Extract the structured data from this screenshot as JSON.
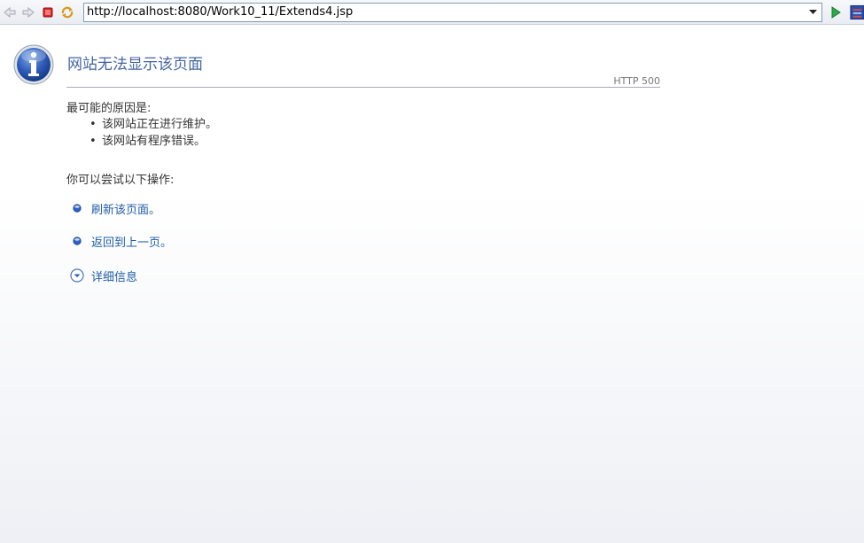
{
  "toolbar": {
    "back_icon": "back-arrow-icon",
    "forward_icon": "forward-arrow-icon",
    "stop_icon": "stop-icon",
    "refresh_icon": "refresh-icon",
    "url": "http://localhost:8080/Work10_11/Extends4.jsp",
    "go_icon": "go-arrow-icon",
    "menu_icon": "menu-icon"
  },
  "error": {
    "icon": "info-icon",
    "title": "网站无法显示该页面",
    "code": "HTTP 500",
    "causes_heading": "最可能的原因是:",
    "causes": [
      "该网站正在进行维护。",
      "该网站有程序错误。"
    ],
    "actions_heading": "你可以尝试以下操作:",
    "actions": [
      {
        "label": "刷新该页面。",
        "icon": "bullet-icon"
      },
      {
        "label": "返回到上一页。",
        "icon": "bullet-icon"
      }
    ],
    "details": {
      "label": "详细信息",
      "icon": "expand-chevron-icon"
    }
  },
  "colors": {
    "title": "#4465a2",
    "link": "#1f5ea8",
    "text": "#333333"
  }
}
